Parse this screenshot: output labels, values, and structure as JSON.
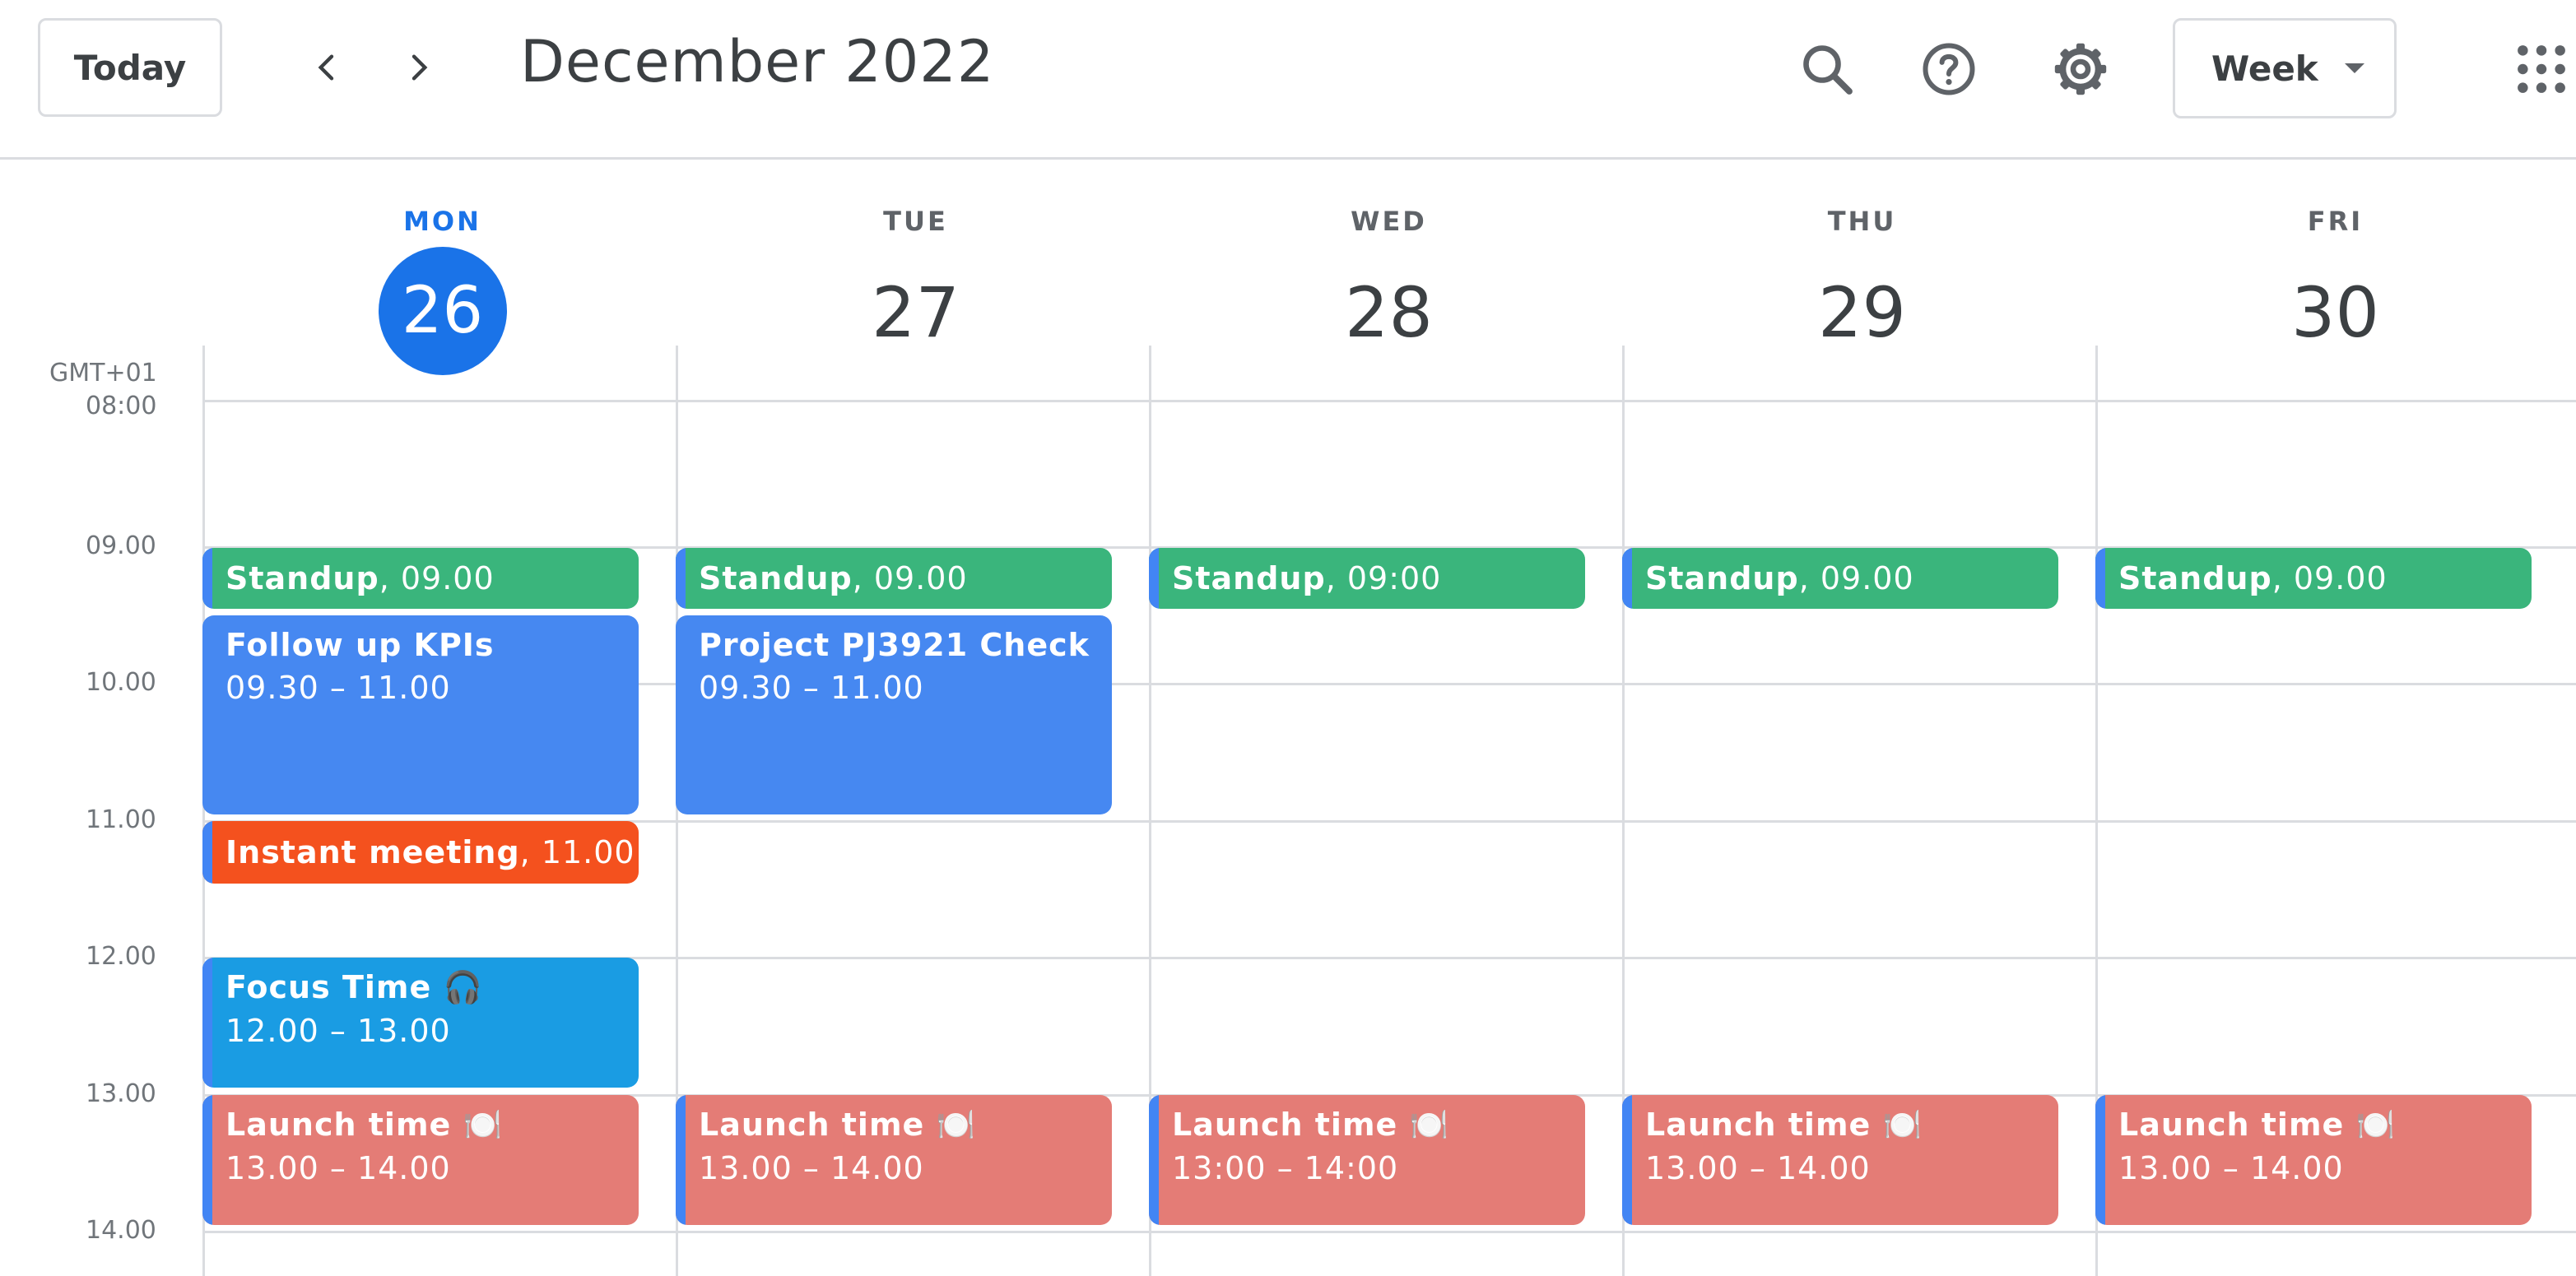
{
  "header": {
    "today_label": "Today",
    "prev_icon": "chevron-left-icon",
    "next_icon": "chevron-right-icon",
    "month_title": "December 2022",
    "search_icon": "search-icon",
    "help_icon": "help-icon",
    "settings_icon": "gear-icon",
    "view_label": "Week",
    "apps_icon": "apps-grid-icon"
  },
  "timezone": "GMT+01",
  "days": [
    {
      "name": "MON",
      "num": "26",
      "today": true
    },
    {
      "name": "TUE",
      "num": "27",
      "today": false
    },
    {
      "name": "WED",
      "num": "28",
      "today": false
    },
    {
      "name": "THU",
      "num": "29",
      "today": false
    },
    {
      "name": "FRI",
      "num": "30",
      "today": false
    }
  ],
  "hours": [
    "08:00",
    "09.00",
    "10.00",
    "11.00",
    "12.00",
    "13.00",
    "14.00"
  ],
  "events": {
    "mon": {
      "standup": {
        "title": "Standup",
        "time": ", 09.00"
      },
      "kpis": {
        "title": "Follow up KPIs",
        "time": "09.30 – 11.00"
      },
      "instant": {
        "title": "Instant meeting",
        "time": ", 11.00"
      },
      "focus": {
        "title": "Focus Time 🎧",
        "time": "12.00 – 13.00"
      },
      "lunch": {
        "title": "Launch time 🍽️",
        "time": "13.00 – 14.00"
      }
    },
    "tue": {
      "standup": {
        "title": "Standup",
        "time": ", 09.00"
      },
      "project": {
        "title": "Project PJ3921 Check",
        "time": "09.30 – 11.00"
      },
      "lunch": {
        "title": "Launch time 🍽️",
        "time": "13.00 – 14.00"
      }
    },
    "wed": {
      "standup": {
        "title": "Standup",
        "time": ", 09:00"
      },
      "lunch": {
        "title": "Launch time 🍽️",
        "time": "13:00 – 14:00"
      }
    },
    "thu": {
      "standup": {
        "title": "Standup",
        "time": ", 09.00"
      },
      "lunch": {
        "title": "Launch time 🍽️",
        "time": "13.00 – 14.00"
      }
    },
    "fri": {
      "standup": {
        "title": "Standup",
        "time": ", 09.00"
      },
      "lunch": {
        "title": "Launch time 🍽️",
        "time": "13.00 – 14.00"
      }
    }
  },
  "colors": {
    "accent": "#1a73e8",
    "standup": "#3ab57c",
    "meeting": "#4688f1",
    "instant": "#f4511e",
    "focus": "#1a9ce3",
    "lunch": "#e47c76",
    "stripe": "#4285f4"
  }
}
